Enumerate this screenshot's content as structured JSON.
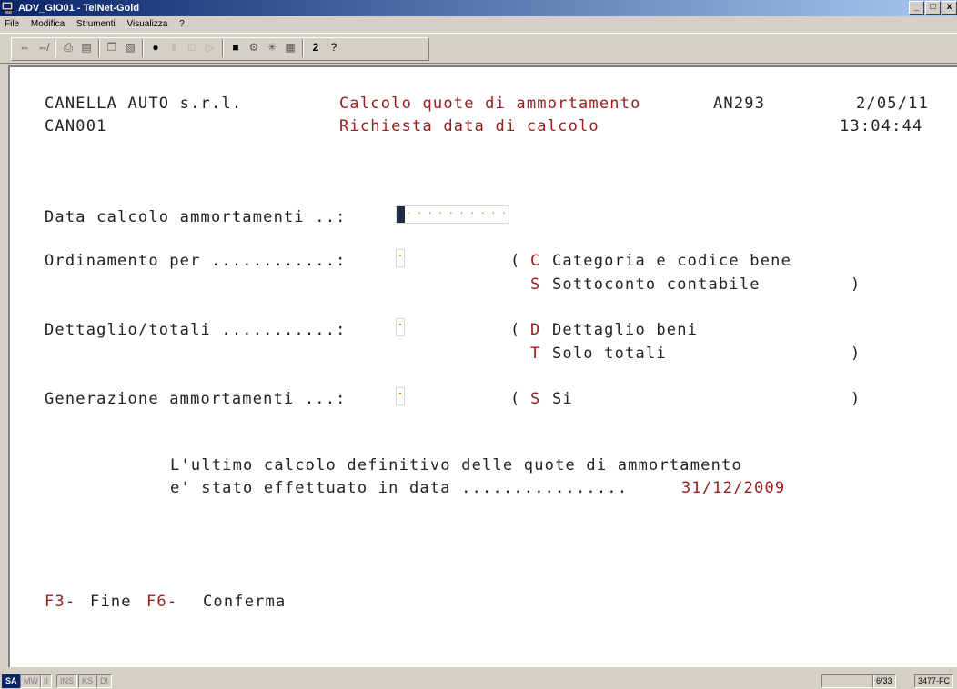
{
  "window": {
    "title": "ADV_GIO01 - TelNet-Gold",
    "buttons": [
      "_",
      "□",
      "x"
    ]
  },
  "menu": [
    "File",
    "Modifica",
    "Strumenti",
    "Visualizza",
    "?"
  ],
  "toolbar_icons": [
    "connect-icon",
    "disconnect-icon",
    "print-icon",
    "properties-icon",
    "copy-icon",
    "paste-icon",
    "record-icon",
    "pause-icon",
    "stop-icon",
    "play-icon",
    "screen-icon",
    "config-icon",
    "keyboard-icon",
    "grid-icon",
    "font-size-icon",
    "help-icon"
  ],
  "header": {
    "company": "CANELLA AUTO s.r.l.",
    "program_title": "Calcolo quote di ammortamento",
    "program_code": "AN293",
    "date": "2/05/11",
    "user": "CAN001",
    "subtitle": "Richiesta data di calcolo",
    "time": "13:04:44"
  },
  "fields": {
    "data_calcolo_label": "Data calcolo ammortamenti ..:",
    "ordinamento_label": "Ordinamento per ............:",
    "dettaglio_label": "Dettaglio/totali ...........:",
    "generazione_label": "Generazione ammortamenti ...:"
  },
  "options": {
    "ord_open": "(",
    "ord_c_key": "C",
    "ord_c_text": "Categoria e codice bene",
    "ord_s_key": "S",
    "ord_s_text": "Sottoconto contabile",
    "ord_close": ")",
    "det_open": "(",
    "det_d_key": "D",
    "det_d_text": "Dettaglio beni",
    "det_t_key": "T",
    "det_t_text": "Solo totali",
    "det_close": ")",
    "gen_open": "(",
    "gen_s_key": "S",
    "gen_s_text": "Si",
    "gen_close": ")"
  },
  "message": {
    "line1": "L'ultimo calcolo definitivo delle quote di ammortamento",
    "line2": "e' stato effettuato in data ................",
    "date": "31/12/2009"
  },
  "fkeys": {
    "f3_key": "F3-",
    "f3_label": "Fine",
    "f6_key": "F6-",
    "f6_label": "Conferma"
  },
  "statusbar": {
    "items": [
      "SA",
      "MW",
      "II",
      "INS",
      "KS",
      "DI"
    ],
    "position": "6/33",
    "code": "3477-FC"
  }
}
